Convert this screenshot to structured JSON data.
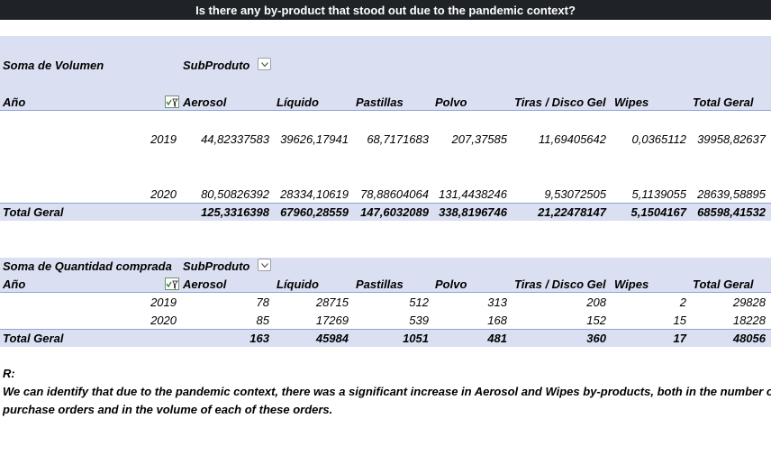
{
  "title": "Is there any by-product that stood out due to the pandemic context?",
  "table1": {
    "values_label": "Soma de Volumen",
    "column_field": "SubProduto",
    "row_field": "Año",
    "columns": [
      "Aerosol",
      "Líquido",
      "Pastillas",
      "Polvo",
      "Tiras / Disco Gel",
      "Wipes",
      "Total Geral"
    ],
    "rows": [
      {
        "year": "2019",
        "cells": [
          "44,82337583",
          "39626,17941",
          "68,7171683",
          "207,37585",
          "11,69405642",
          "0,0365112",
          "39958,82637"
        ]
      },
      {
        "year": "2020",
        "cells": [
          "80,50826392",
          "28334,10619",
          "78,88604064",
          "131,4438246",
          "9,53072505",
          "5,1139055",
          "28639,58895"
        ]
      }
    ],
    "total": {
      "label": "Total Geral",
      "cells": [
        "125,3316398",
        "67960,28559",
        "147,6032089",
        "338,8196746",
        "21,22478147",
        "5,1504167",
        "68598,41532"
      ]
    }
  },
  "table2": {
    "values_label": "Soma de Quantidad comprada",
    "column_field": "SubProduto",
    "row_field": "Año",
    "columns": [
      "Aerosol",
      "Líquido",
      "Pastillas",
      "Polvo",
      "Tiras / Disco Gel",
      "Wipes",
      "Total Geral"
    ],
    "rows": [
      {
        "year": "2019",
        "cells": [
          "78",
          "28715",
          "512",
          "313",
          "208",
          "2",
          "29828"
        ]
      },
      {
        "year": "2020",
        "cells": [
          "85",
          "17269",
          "539",
          "168",
          "152",
          "15",
          "18228"
        ]
      }
    ],
    "total": {
      "label": "Total Geral",
      "cells": [
        "163",
        "45984",
        "1051",
        "481",
        "360",
        "17",
        "48056"
      ]
    }
  },
  "note": {
    "label": "R:",
    "line1": "We can identify that due to the pandemic context, there was a significant increase in Aerosol and Wipes by-products, both in the number of",
    "line2": "purchase orders and in the volume of each of these orders."
  },
  "icons": {
    "filter": "filter-dropdown-icon",
    "sort": "sort-filter-icon"
  }
}
